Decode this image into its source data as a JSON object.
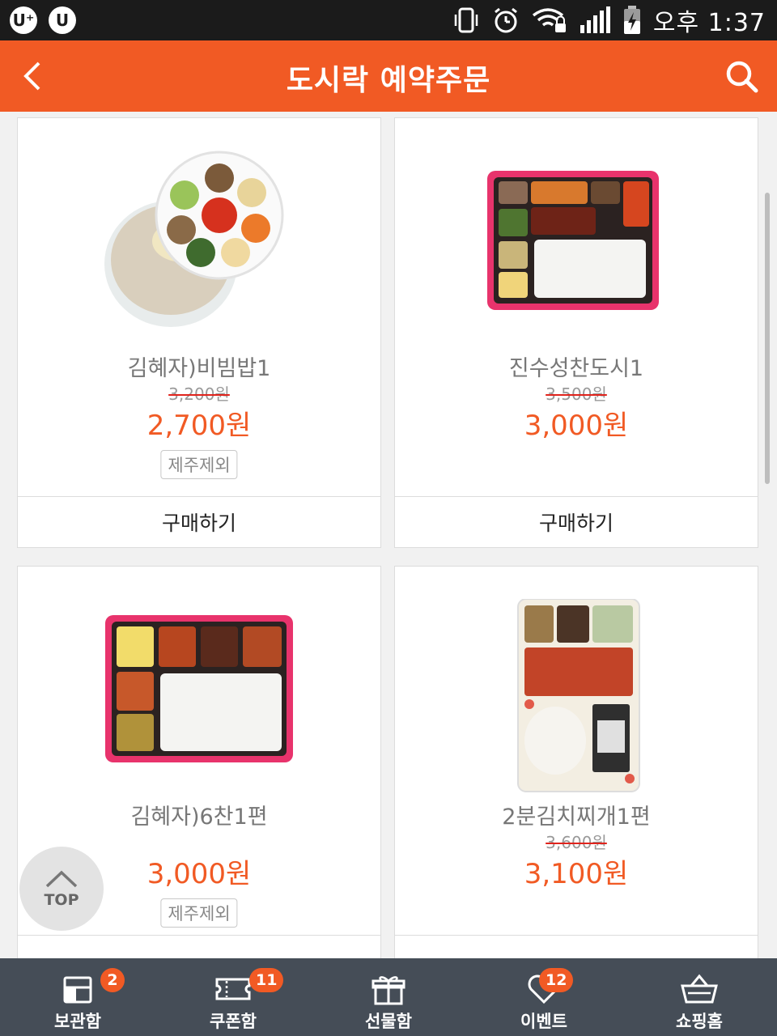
{
  "status_bar": {
    "left_badges": [
      "U⁺",
      "U"
    ],
    "time": "오후 1:37"
  },
  "header": {
    "title": "도시락 예약주문"
  },
  "products": [
    {
      "name": "김혜자)비빔밥1",
      "original_price": "3,200원",
      "price": "2,700원",
      "tag": "제주제외",
      "buy_label": "구매하기"
    },
    {
      "name": "진수성찬도시1",
      "original_price": "3,500원",
      "price": "3,000원",
      "tag": "",
      "buy_label": "구매하기"
    },
    {
      "name": "김혜자)6찬1편",
      "original_price": "",
      "price": "3,000원",
      "tag": "제주제외",
      "buy_label": ""
    },
    {
      "name": "2분김치찌개1편",
      "original_price": "3,600원",
      "price": "3,100원",
      "tag": "",
      "buy_label": ""
    }
  ],
  "top_button": {
    "label": "TOP"
  },
  "bottom_nav": [
    {
      "label": "보관함",
      "badge": "2",
      "icon": "storage-box-icon"
    },
    {
      "label": "쿠폰함",
      "badge": "11",
      "icon": "coupon-ticket-icon"
    },
    {
      "label": "선물함",
      "badge": "",
      "icon": "gift-box-icon"
    },
    {
      "label": "이벤트",
      "badge": "12",
      "icon": "heart-icon"
    },
    {
      "label": "쇼핑홈",
      "badge": "",
      "icon": "shopping-basket-icon"
    }
  ],
  "colors": {
    "accent": "#f15a24",
    "nav_bg": "#454d57",
    "strike": "#e0231c"
  }
}
